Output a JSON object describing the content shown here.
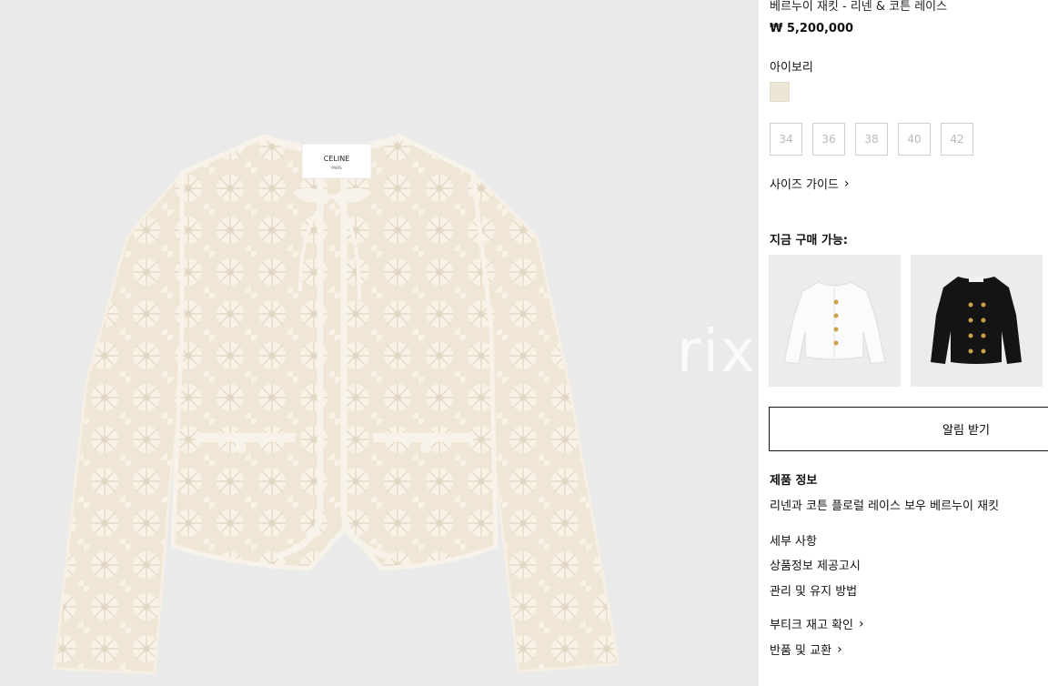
{
  "product": {
    "title": "베르누이 재킷 - 리넨 & 코튼 레이스",
    "price": "₩ 5,200,000",
    "color_name": "아이보리",
    "color_hex": "#ece6d4",
    "label_brand": "CELINE",
    "label_sub": "PARIS"
  },
  "watermark": "rixx",
  "sizes": [
    "34",
    "36",
    "38",
    "40",
    "42"
  ],
  "size_guide": "사이즈 가이드",
  "available_heading": "지금 구매 가능:",
  "notify_button": "알림 받기",
  "product_info": {
    "heading": "제품 정보",
    "description": "리넨과 코튼 플로럴 레이스 보우 베르누이 재킷"
  },
  "links": {
    "details": "세부 사항",
    "notice": "상품정보 제공고시",
    "care": "관리 및 유지 방법",
    "boutique": "부티크 재고 확인",
    "returns": "반품 및 교환"
  },
  "colors": {
    "background": "#eaeaea",
    "lace": "#f3ecdf",
    "accent": "#111111"
  }
}
